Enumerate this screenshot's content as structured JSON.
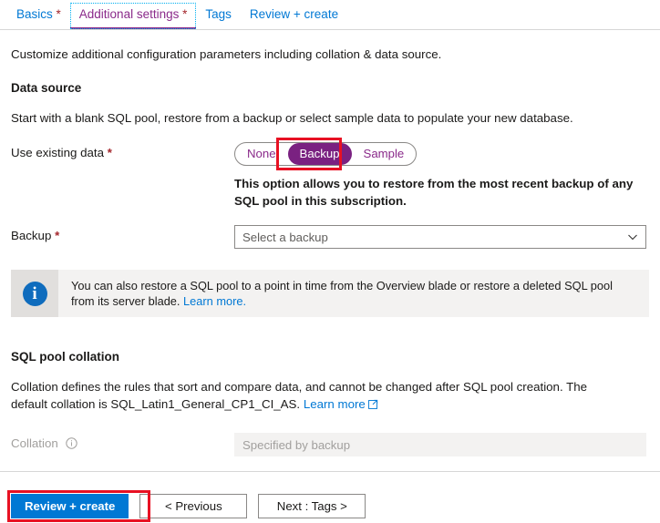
{
  "tabs": [
    {
      "label": "Basics",
      "required": true,
      "active": false
    },
    {
      "label": "Additional settings",
      "required": true,
      "active": true
    },
    {
      "label": "Tags",
      "required": false,
      "active": false
    },
    {
      "label": "Review + create",
      "required": false,
      "active": false
    }
  ],
  "intro": "Customize additional configuration parameters including collation & data source.",
  "data_source": {
    "title": "Data source",
    "description": "Start with a blank SQL pool, restore from a backup or select sample data to populate your new database.",
    "use_existing_data": {
      "label": "Use existing data",
      "required_marker": "*",
      "options": [
        "None",
        "Backup",
        "Sample"
      ],
      "selected": "Backup",
      "highlight_color": "#e81123",
      "selected_color": "#7a2181"
    },
    "helper_text": "This option allows you to restore from the most recent backup of any SQL pool in this subscription.",
    "backup": {
      "label": "Backup",
      "required_marker": "*",
      "placeholder": "Select a backup",
      "value": "Select a backup",
      "chevron_icon": "chevron-down-icon"
    }
  },
  "info_banner": {
    "icon": "info-icon",
    "text": "You can also restore a SQL pool to a point in time from the Overview blade or restore a deleted SQL pool from its server blade.",
    "link_label": "Learn more.",
    "link_color": "#0078d4"
  },
  "collation_section": {
    "title": "SQL pool collation",
    "description_part1": "Collation defines the rules that sort and compare data, and cannot be changed after SQL pool creation. The default collation is SQL_Latin1_General_CP1_CI_AS.",
    "link_label": "Learn more",
    "link_icon": "external-link-icon",
    "collation": {
      "label": "Collation",
      "info_icon": "info-circle-icon",
      "value": "Specified by backup",
      "disabled": true
    }
  },
  "footer": {
    "primary_button": "Review + create",
    "previous_button": "< Previous",
    "next_button": "Next : Tags >",
    "primary_color": "#0078d4",
    "highlight_color": "#e81123"
  }
}
